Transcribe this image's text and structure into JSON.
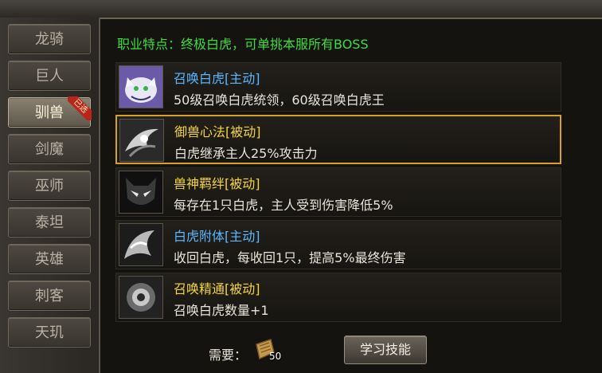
{
  "sidebar": {
    "tabs": [
      {
        "label": "龙骑"
      },
      {
        "label": "巨人"
      },
      {
        "label": "驯兽",
        "badge": "已选"
      },
      {
        "label": "剑魔"
      },
      {
        "label": "巫师"
      },
      {
        "label": "泰坦"
      },
      {
        "label": "英雄"
      },
      {
        "label": "刺客"
      },
      {
        "label": "天玑"
      }
    ]
  },
  "header": "职业特点：终极白虎，可单挑本服所有BOSS",
  "skills": [
    {
      "name": "召唤白虎[主动]",
      "desc": "50级召唤白虎统领，60级召唤白虎王",
      "icon": "white-tiger-icon"
    },
    {
      "name": "御兽心法[被动]",
      "desc": "白虎继承主人25%攻击力",
      "icon": "beast-mind-icon"
    },
    {
      "name": "兽神羁绊[被动]",
      "desc": "每存在1只白虎，主人受到伤害降低5%",
      "icon": "beast-bond-icon"
    },
    {
      "name": "白虎附体[主动]",
      "desc": "收回白虎，每收回1只，提高5%最终伤害",
      "icon": "tiger-possession-icon"
    },
    {
      "name": "召唤精通[被动]",
      "desc": "召唤白虎数量+1",
      "icon": "summon-mastery-icon"
    }
  ],
  "footer": {
    "need_label": "需要：",
    "item_count": "50",
    "item_icon": "scroll-item-icon",
    "learn_button": "学习技能"
  },
  "colors": {
    "active_skill": "#5ab7ff",
    "passive_skill": "#f2d53c",
    "header": "#3fdc3f",
    "selected_border": "#d9a21c"
  }
}
